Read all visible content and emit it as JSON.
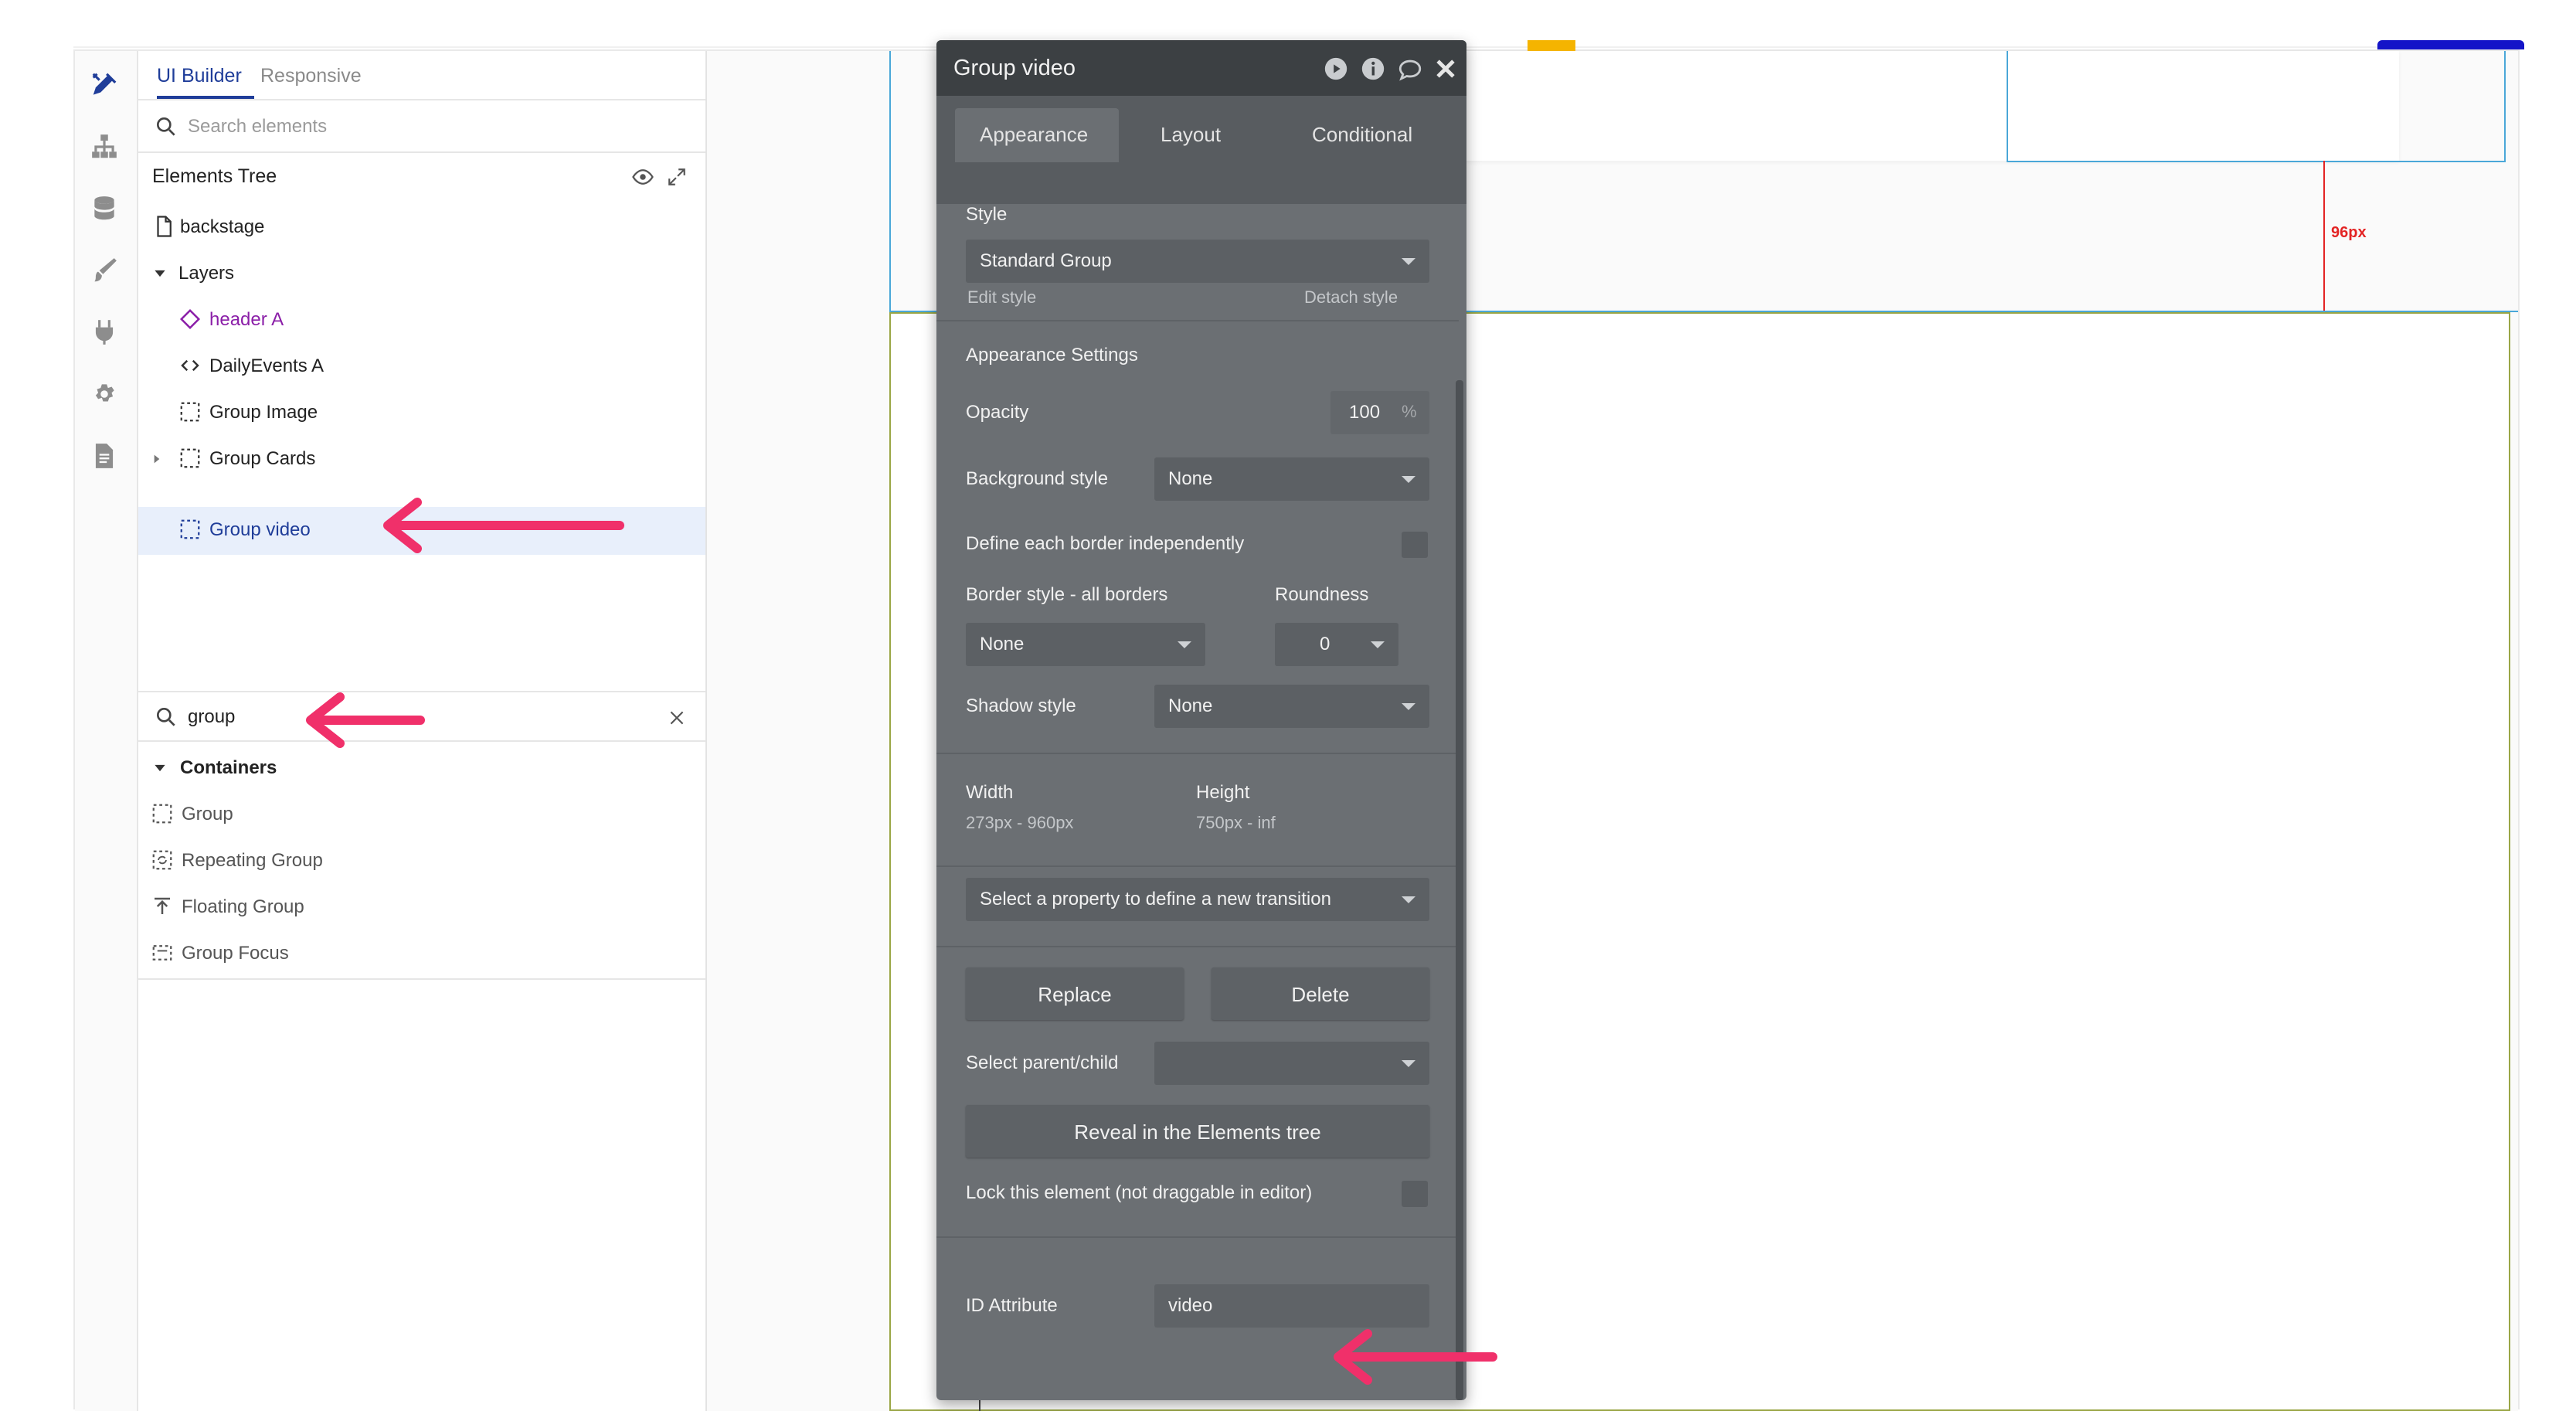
{
  "left_tabs": {
    "ui_builder": "UI Builder",
    "responsive": "Responsive"
  },
  "search": {
    "placeholder": "Search elements"
  },
  "tree": {
    "title": "Elements Tree",
    "page": "backstage",
    "layers": "Layers",
    "items": [
      {
        "label": "header A"
      },
      {
        "label": "DailyEvents A"
      },
      {
        "label": "Group Image"
      },
      {
        "label": "Group Cards"
      },
      {
        "label": "Group video"
      }
    ]
  },
  "element_search": {
    "value": "group"
  },
  "containers": {
    "title": "Containers",
    "items": [
      {
        "label": "Group"
      },
      {
        "label": "Repeating Group"
      },
      {
        "label": "Floating Group"
      },
      {
        "label": "Group Focus"
      }
    ]
  },
  "canvas": {
    "spacing_label": "96px"
  },
  "property_editor": {
    "title": "Group video",
    "tabs": [
      "Appearance",
      "Layout",
      "Conditional"
    ],
    "style_label": "Style",
    "style_value": "Standard Group",
    "edit_style": "Edit style",
    "detach_style": "Detach style",
    "appearance_settings": "Appearance Settings",
    "opacity_label": "Opacity",
    "opacity_value": "100",
    "opacity_unit": "%",
    "background_style_label": "Background style",
    "background_style_value": "None",
    "border_independent_label": "Define each border independently",
    "border_style_label": "Border style - all borders",
    "roundness_label": "Roundness",
    "border_style_value": "None",
    "roundness_value": "0",
    "shadow_style_label": "Shadow style",
    "shadow_style_value": "None",
    "width_label": "Width",
    "width_value": "273px - 960px",
    "height_label": "Height",
    "height_value": "750px - inf",
    "transition_placeholder": "Select a property to define a new transition",
    "replace_button": "Replace",
    "delete_button": "Delete",
    "parent_child_label": "Select parent/child",
    "reveal_button": "Reveal in the Elements tree",
    "lock_label": "Lock this element (not draggable in editor)",
    "id_attribute_label": "ID Attribute",
    "id_attribute_value": "video"
  },
  "colors": {
    "accent_blue": "#1f3d99",
    "selected_row": "#e8effb",
    "annotation_arrow": "#f0306a",
    "panel_bg": "#6b6f73",
    "panel_header": "#3c4043"
  }
}
